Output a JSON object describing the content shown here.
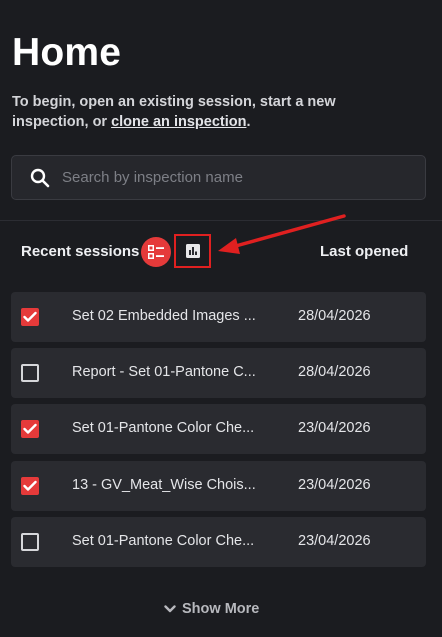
{
  "page": {
    "title": "Home",
    "intro_text": "To begin, open an existing session, start a new inspection, or ",
    "intro_link": "clone an inspection",
    "intro_end": "."
  },
  "search": {
    "placeholder": "Search by inspection name",
    "value": "",
    "icon": "search-icon"
  },
  "sessions_header": {
    "recent_label": "Recent sessions",
    "last_opened_label": "Last opened",
    "list_view_icon": "list-view-icon",
    "chart_view_icon": "bar-chart-icon"
  },
  "sessions": [
    {
      "name": "Set 02 Embedded Images ...",
      "date": "28/04/2026",
      "checked": true
    },
    {
      "name": "Report - Set 01-Pantone C...",
      "date": "28/04/2026",
      "checked": false
    },
    {
      "name": "Set 01-Pantone Color Che...",
      "date": "23/04/2026",
      "checked": true
    },
    {
      "name": "13 - GV_Meat_Wise Chois...",
      "date": "23/04/2026",
      "checked": true
    },
    {
      "name": "Set 01-Pantone Color Che...",
      "date": "23/04/2026",
      "checked": false
    }
  ],
  "footer": {
    "show_more_label": "Show More",
    "show_more_icon": "chevron-down-icon"
  },
  "colors": {
    "accent": "#e53a3a",
    "annotation": "#e02020",
    "background": "#1b1c20",
    "row_background": "#2a2b30"
  }
}
